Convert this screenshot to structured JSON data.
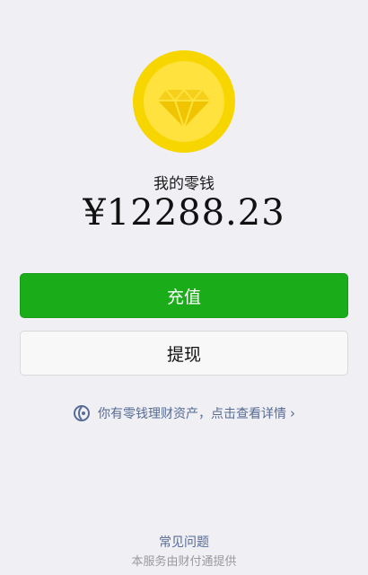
{
  "wallet": {
    "title": "我的零钱",
    "balance": "¥12288.23"
  },
  "actions": {
    "recharge_label": "充值",
    "withdraw_label": "提现"
  },
  "wealth_link": {
    "text": "你有零钱理财资产，点击查看详情",
    "icon": "wealth-icon",
    "chevron": "›"
  },
  "footer": {
    "faq_label": "常见问题",
    "provider_text": "本服务由财付通提供"
  },
  "colors": {
    "primary_green": "#1aad19",
    "link_blue": "#576b95",
    "coin_gold": "#f7d600",
    "background": "#efeff4"
  }
}
